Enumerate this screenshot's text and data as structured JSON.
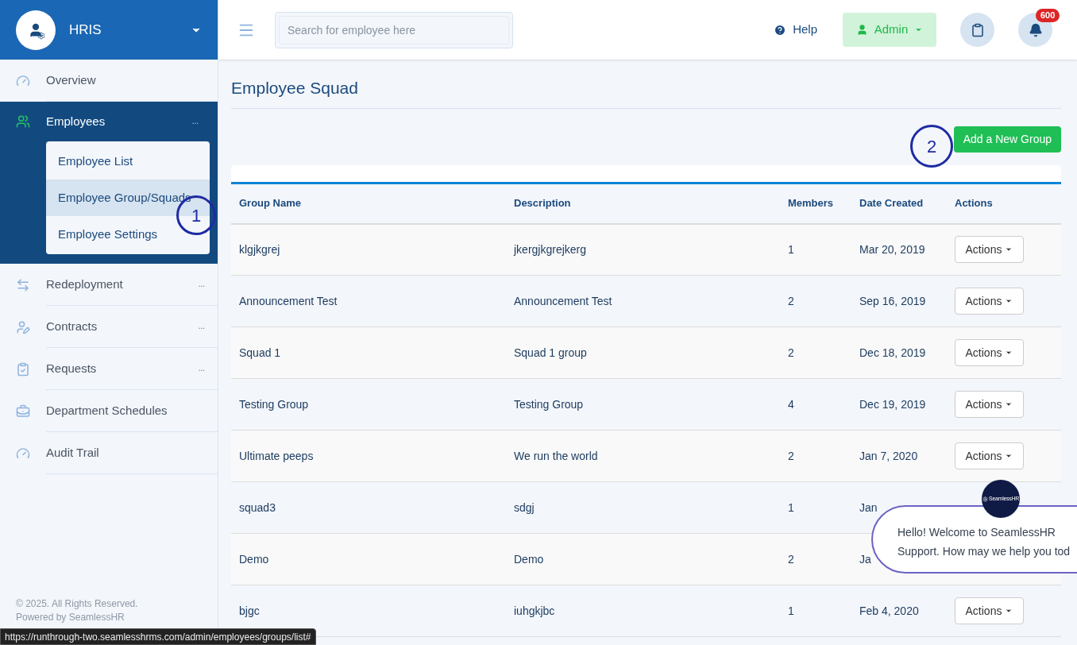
{
  "sidebar": {
    "brand": "HRIS",
    "items": [
      {
        "label": "Overview",
        "expanded": false
      },
      {
        "label": "Employees",
        "more": "...",
        "expanded": true,
        "children": [
          {
            "label": "Employee List",
            "selected": false
          },
          {
            "label": "Employee Group/Squads",
            "selected": true
          },
          {
            "label": "Employee Settings",
            "selected": false
          }
        ]
      },
      {
        "label": "Redeployment",
        "more": "...",
        "expanded": false
      },
      {
        "label": "Contracts",
        "more": "...",
        "expanded": false
      },
      {
        "label": "Requests",
        "more": "...",
        "expanded": false
      },
      {
        "label": "Department Schedules",
        "expanded": false
      },
      {
        "label": "Audit Trail",
        "expanded": false
      }
    ],
    "footer": [
      "© 2025. All Rights Reserved.",
      "Powered by SeamlessHR"
    ]
  },
  "topbar": {
    "search": {
      "placeholder": "Search for employee here"
    },
    "help": "Help",
    "user": "Admin",
    "notifications": "600"
  },
  "page": {
    "title": "Employee Squad",
    "add_button": "Add a New Group"
  },
  "table": {
    "columns": [
      "Group Name",
      "Description",
      "Members",
      "Date Created",
      "Actions"
    ],
    "rows": [
      {
        "name": "klgjkgrej",
        "description": "jkergjkgrejkerg",
        "members": "1",
        "date": "Mar 20, 2019",
        "action_label": "Actions"
      },
      {
        "name": "Announcement Test",
        "description": "Announcement Test",
        "members": "2",
        "date": "Sep 16, 2019",
        "action_label": "Actions"
      },
      {
        "name": "Squad 1",
        "description": "Squad 1 group",
        "members": "2",
        "date": "Dec 18, 2019",
        "action_label": "Actions"
      },
      {
        "name": "Testing Group",
        "description": "Testing Group",
        "members": "4",
        "date": "Dec 19, 2019",
        "action_label": "Actions"
      },
      {
        "name": "Ultimate peeps",
        "description": "We run the world",
        "members": "2",
        "date": "Jan 7, 2020",
        "action_label": "Actions"
      },
      {
        "name": "squad3",
        "description": "sdgj",
        "members": "1",
        "date": "Jan"
      },
      {
        "name": "Demo",
        "description": "Demo",
        "members": "2",
        "date": "Ja"
      },
      {
        "name": "bjgc",
        "description": "iuhgkjbc",
        "members": "1",
        "date": "Feb 4, 2020",
        "action_label": "Actions"
      }
    ]
  },
  "annotations": [
    "1",
    "2"
  ],
  "chat": {
    "logo": "SeamlessHR",
    "message": "Hello! Welcome to SeamlessHR Support. How may we help you tod"
  },
  "status_url": "https://runthrough-two.seamlesshrms.com/admin/employees/groups/list#"
}
